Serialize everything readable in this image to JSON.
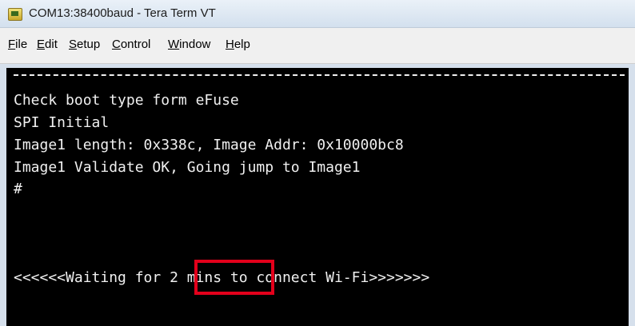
{
  "window": {
    "title": "COM13:38400baud - Tera Term VT",
    "icon": "tera-term-icon"
  },
  "menubar": {
    "items": [
      "File",
      "Edit",
      "Setup",
      "Control",
      "Window",
      "Help"
    ]
  },
  "terminal": {
    "separator": "==============================================================",
    "lines": [
      "Check boot type form eFuse",
      "SPI Initial",
      "Image1 length: 0x338c, Image Addr: 0x10000bc8",
      "Image1 Validate OK, Going jump to Image1",
      "#"
    ],
    "waiting_line": "<<<<<<Waiting for 2 mins to connect Wi-Fi>>>>>>>",
    "highlight_text": "2 mins",
    "highlight_color": "#e3001b"
  },
  "colors": {
    "terminal_bg": "#000000",
    "terminal_fg": "#f0f0f0"
  }
}
